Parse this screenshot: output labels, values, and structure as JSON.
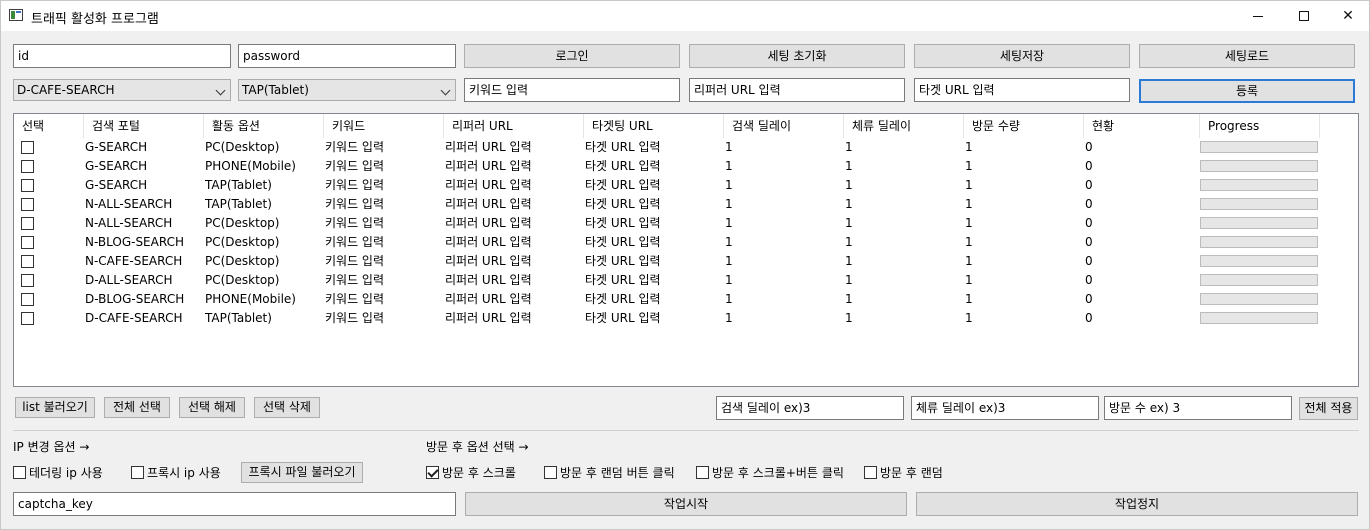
{
  "window": {
    "title": "트래픽 활성화 프로그램"
  },
  "login": {
    "id_value": "id",
    "password_value": "password",
    "login_label": "로그인",
    "reset_label": "세팅 초기화",
    "save_label": "세팅저장",
    "load_label": "세팅로드"
  },
  "entry": {
    "portal_selected": "D-CAFE-SEARCH",
    "device_selected": "TAP(Tablet)",
    "keyword_value": "키워드 입력",
    "referrer_value": "리퍼러 URL 입력",
    "target_value": "타겟 URL 입력",
    "register_label": "등록"
  },
  "table": {
    "columns": [
      "선택",
      "검색 포털",
      "활동 옵션",
      "키워드",
      "리퍼러 URL",
      "타겟팅 URL",
      "검색 딜레이",
      "체류 딜레이",
      "방문 수량",
      "현황",
      "Progress"
    ],
    "rows": [
      {
        "portal": "G-SEARCH",
        "option": "PC(Desktop)",
        "keyword": "키워드 입력",
        "referrer": "리퍼러 URL 입력",
        "target": "타겟 URL 입력",
        "search_delay": "1",
        "stay_delay": "1",
        "visits": "1",
        "status": "0",
        "progress": 0
      },
      {
        "portal": "G-SEARCH",
        "option": "PHONE(Mobile)",
        "keyword": "키워드 입력",
        "referrer": "리퍼러 URL 입력",
        "target": "타겟 URL 입력",
        "search_delay": "1",
        "stay_delay": "1",
        "visits": "1",
        "status": "0",
        "progress": 0
      },
      {
        "portal": "G-SEARCH",
        "option": "TAP(Tablet)",
        "keyword": "키워드 입력",
        "referrer": "리퍼러 URL 입력",
        "target": "타겟 URL 입력",
        "search_delay": "1",
        "stay_delay": "1",
        "visits": "1",
        "status": "0",
        "progress": 0
      },
      {
        "portal": "N-ALL-SEARCH",
        "option": "TAP(Tablet)",
        "keyword": "키워드 입력",
        "referrer": "리퍼러 URL 입력",
        "target": "타겟 URL 입력",
        "search_delay": "1",
        "stay_delay": "1",
        "visits": "1",
        "status": "0",
        "progress": 0
      },
      {
        "portal": "N-ALL-SEARCH",
        "option": "PC(Desktop)",
        "keyword": "키워드 입력",
        "referrer": "리퍼러 URL 입력",
        "target": "타겟 URL 입력",
        "search_delay": "1",
        "stay_delay": "1",
        "visits": "1",
        "status": "0",
        "progress": 0
      },
      {
        "portal": "N-BLOG-SEARCH",
        "option": "PC(Desktop)",
        "keyword": "키워드 입력",
        "referrer": "리퍼러 URL 입력",
        "target": "타겟 URL 입력",
        "search_delay": "1",
        "stay_delay": "1",
        "visits": "1",
        "status": "0",
        "progress": 0
      },
      {
        "portal": "N-CAFE-SEARCH",
        "option": "PC(Desktop)",
        "keyword": "키워드 입력",
        "referrer": "리퍼러 URL 입력",
        "target": "타겟 URL 입력",
        "search_delay": "1",
        "stay_delay": "1",
        "visits": "1",
        "status": "0",
        "progress": 0
      },
      {
        "portal": "D-ALL-SEARCH",
        "option": "PC(Desktop)",
        "keyword": "키워드 입력",
        "referrer": "리퍼러 URL 입력",
        "target": "타겟 URL 입력",
        "search_delay": "1",
        "stay_delay": "1",
        "visits": "1",
        "status": "0",
        "progress": 0
      },
      {
        "portal": "D-BLOG-SEARCH",
        "option": "PHONE(Mobile)",
        "keyword": "키워드 입력",
        "referrer": "리퍼러 URL 입력",
        "target": "타겟 URL 입력",
        "search_delay": "1",
        "stay_delay": "1",
        "visits": "1",
        "status": "0",
        "progress": 0
      },
      {
        "portal": "D-CAFE-SEARCH",
        "option": "TAP(Tablet)",
        "keyword": "키워드 입력",
        "referrer": "리퍼러 URL 입력",
        "target": "타겟 URL 입력",
        "search_delay": "1",
        "stay_delay": "1",
        "visits": "1",
        "status": "0",
        "progress": 0
      }
    ]
  },
  "list_actions": {
    "load_list_label": "list 불러오기",
    "select_all_label": "전체 선택",
    "deselect_label": "선택 해제",
    "delete_selected_label": "선택 삭제",
    "search_delay_value": "검색 딜레이 ex)3",
    "stay_delay_value": "체류 딜레이 ex)3",
    "visit_count_value": "방문 수 ex) 3",
    "apply_all_label": "전체 적용"
  },
  "ip_options": {
    "heading": "IP 변경 옵션 →",
    "tethering_label": "테더링 ip 사용",
    "tethering_checked": false,
    "proxy_label": "프록시 ip 사용",
    "proxy_checked": false,
    "proxy_file_label": "프록시 파일 불러오기"
  },
  "after_visit": {
    "heading": "방문 후 옵션 선택 →",
    "options": [
      {
        "label": "방문 후 스크롤",
        "checked": true
      },
      {
        "label": "방문 후 랜덤 버튼 클릭",
        "checked": false
      },
      {
        "label": "방문 후 스크롤+버튼 클릭",
        "checked": false
      },
      {
        "label": "방문 후 랜덤",
        "checked": false
      }
    ]
  },
  "footer": {
    "captcha_value": "captcha_key",
    "start_label": "작업시작",
    "stop_label": "작업정지"
  },
  "colors": {
    "accent": "#2a7ad6",
    "progress_fill": "#06b025"
  }
}
